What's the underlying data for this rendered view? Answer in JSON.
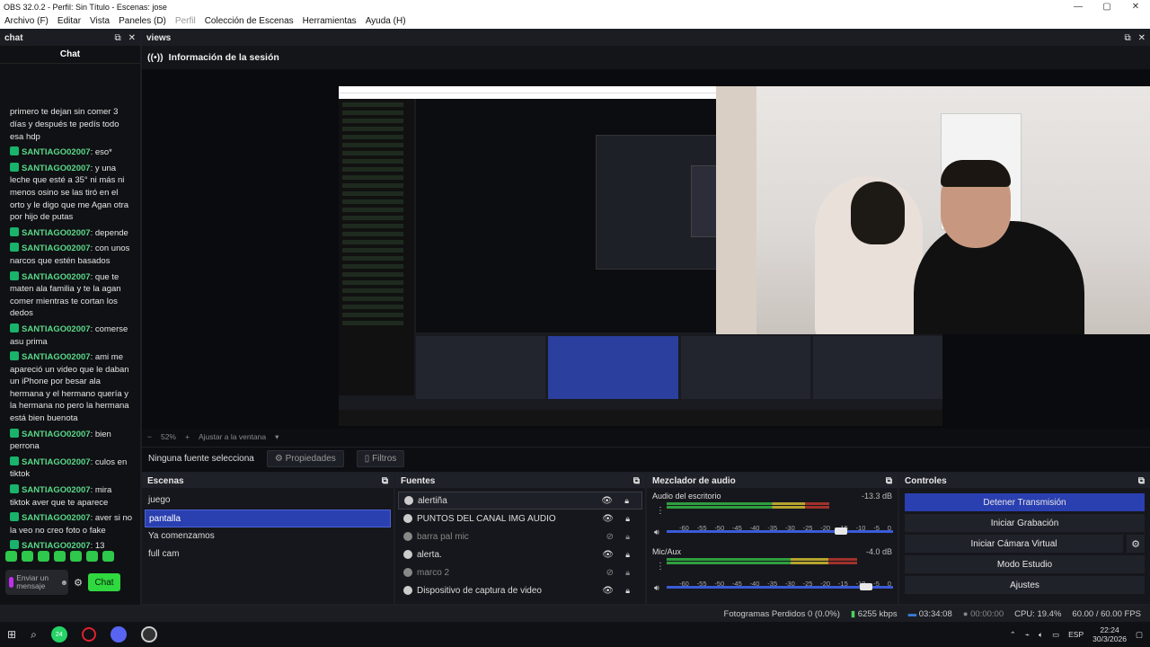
{
  "window": {
    "title": "OBS 32.0.2 - Perfil: Sin Título - Escenas: jose",
    "controls": {
      "minimize": "—",
      "maximize": "▢",
      "close": "✕"
    }
  },
  "menu": {
    "items": [
      "Archivo (F)",
      "Editar",
      "Vista",
      "Paneles (D)",
      "Perfil",
      "Colección de Escenas",
      "Herramientas",
      "Ayuda (H)"
    ]
  },
  "chat_dock": {
    "title": "chat",
    "header": "Chat",
    "messages": [
      {
        "user": "",
        "text": "primero te dejan sin comer 3 días y después te pedís todo esa hdp"
      },
      {
        "user": "SANTIAGO02007",
        "text": ": eso*"
      },
      {
        "user": "SANTIAGO02007",
        "text": ": y una leche que esté a 35° ni más ni menos osino se las tiró en el orto y le digo que me Agan otra por hijo de putas"
      },
      {
        "user": "SANTIAGO02007",
        "text": ": depende"
      },
      {
        "user": "SANTIAGO02007",
        "text": ": con unos narcos que estén basados"
      },
      {
        "user": "SANTIAGO02007",
        "text": ": que te maten ala familia y te la agan comer mientras te cortan los dedos"
      },
      {
        "user": "SANTIAGO02007",
        "text": ": comerse asu prima"
      },
      {
        "user": "SANTIAGO02007",
        "text": ": ami me apareció un video que le daban un iPhone por besar ala hermana y el hermano quería y la hermana no pero la hermana está bien buenota"
      },
      {
        "user": "SANTIAGO02007",
        "text": ": bien perrona"
      },
      {
        "user": "SANTIAGO02007",
        "text": ": culos en tiktok"
      },
      {
        "user": "SANTIAGO02007",
        "text": ": mira tiktok aver que te aparece"
      },
      {
        "user": "SANTIAGO02007",
        "text": ": aver si no la veo no creo foto o fake"
      },
      {
        "user": "SANTIAGO02007",
        "text": ": 13"
      }
    ],
    "input_placeholder": "Enviar un mensaje",
    "send_label": "Chat"
  },
  "views_dock": {
    "title": "views",
    "session_label": "Información de la sesión",
    "zoom_percent": "52%",
    "fit_label": "Ajustar a la ventana",
    "no_source": "Ninguna fuente selecciona",
    "properties_label": "Propiedades",
    "filters_label": "Filtros"
  },
  "scenes": {
    "title": "Escenas",
    "items": [
      {
        "label": "juego",
        "selected": false
      },
      {
        "label": "pantalla",
        "selected": true
      },
      {
        "label": "Ya comenzamos",
        "selected": false
      },
      {
        "label": "full cam",
        "selected": false
      }
    ]
  },
  "sources": {
    "title": "Fuentes",
    "items": [
      {
        "label": "alertiña",
        "visible": true
      },
      {
        "label": "PUNTOS DEL CANAL IMG AUDIO",
        "visible": true
      },
      {
        "label": "barra pal mic",
        "visible": false
      },
      {
        "label": "alerta.",
        "visible": true
      },
      {
        "label": "marco 2",
        "visible": false
      },
      {
        "label": "Dispositivo de captura de video",
        "visible": true
      }
    ]
  },
  "mixer": {
    "title": "Mezclador de audio",
    "channels": [
      {
        "name": "Audio del escritorio",
        "db": "-13.3 dB",
        "level": 0.72,
        "volume": 0.77
      },
      {
        "name": "Mic/Aux",
        "db": "-4.0 dB",
        "level": 0.84,
        "volume": 0.88
      }
    ],
    "ticks": [
      "-60",
      "-55",
      "-50",
      "-45",
      "-40",
      "-35",
      "-30",
      "-25",
      "-20",
      "-15",
      "-10",
      "-5",
      "0"
    ]
  },
  "controls": {
    "title": "Controles",
    "stop_stream": "Detener Transmisión",
    "start_recording": "Iniciar Grabación",
    "virtual_cam": "Iniciar Cámara Virtual",
    "studio_mode": "Modo Estudio",
    "settings": "Ajustes"
  },
  "status": {
    "dropped": "Fotogramas Perdidos 0 (0.0%)",
    "bitrate": "6255 kbps",
    "stream_time": "03:34:08",
    "rec_time": "00:00:00",
    "cpu": "CPU: 19.4%",
    "fps": "60.00 / 60.00 FPS"
  },
  "taskbar": {
    "whatsapp_badge": "24",
    "lang": "ESP",
    "time": "22:24",
    "date": "30/3/2026"
  }
}
